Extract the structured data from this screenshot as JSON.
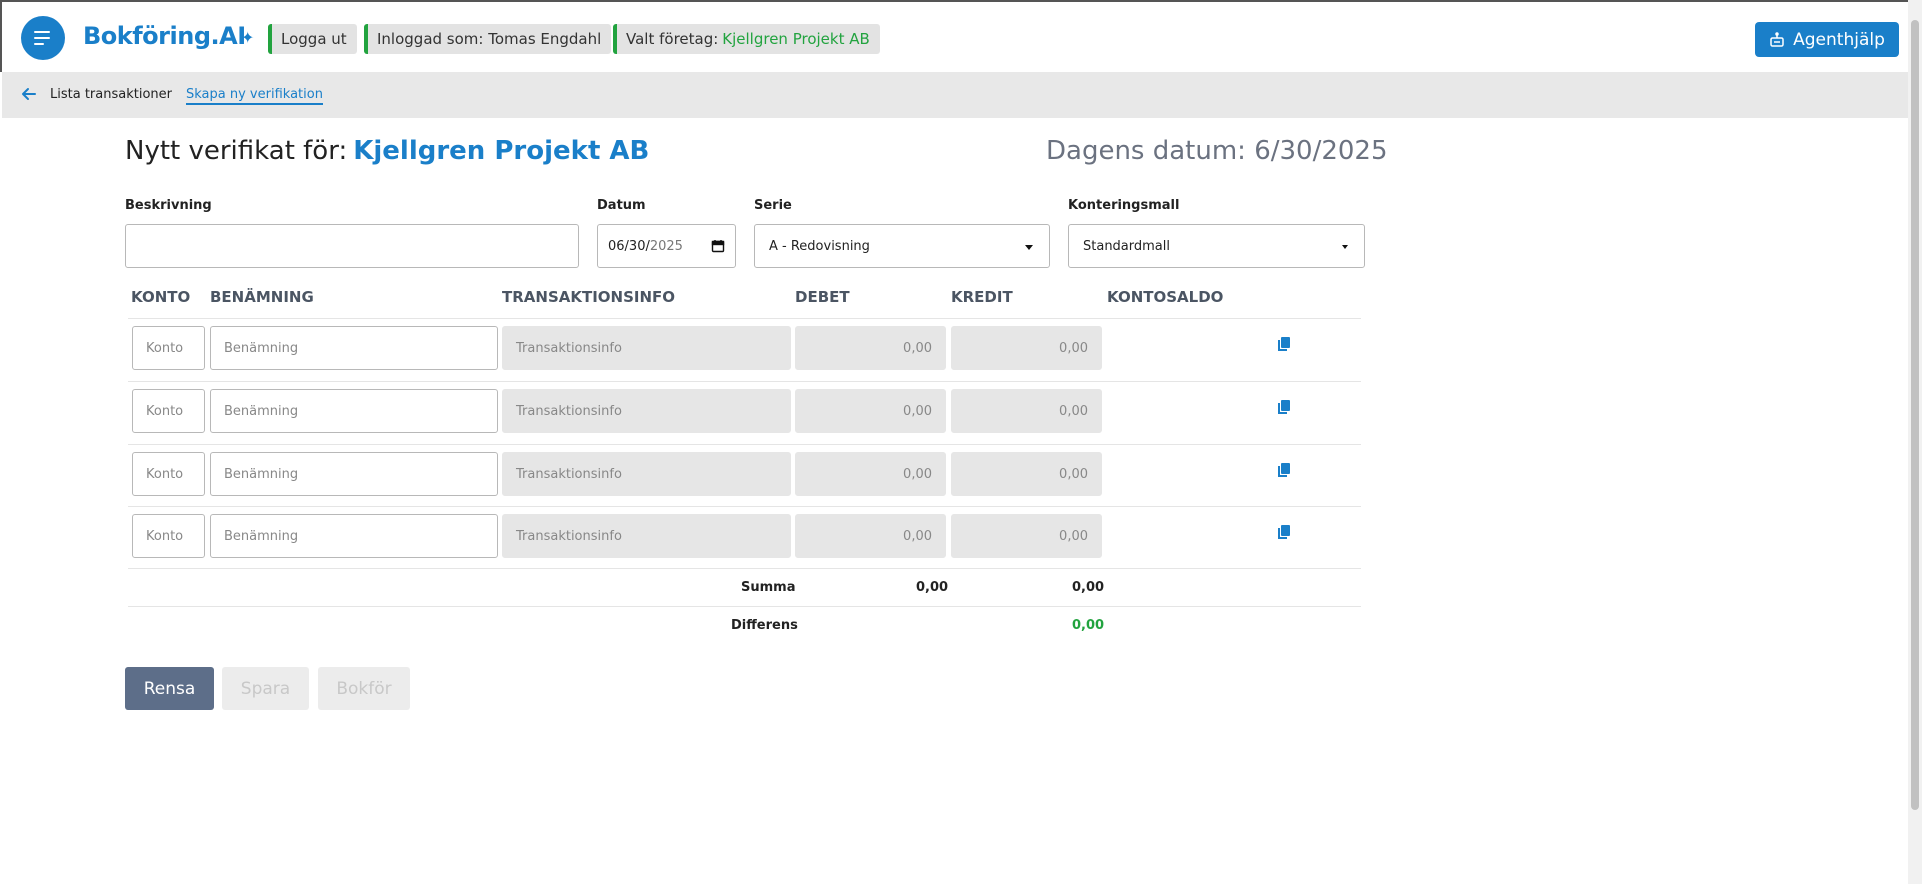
{
  "header": {
    "logo": "Bokföring.AI",
    "logo_star": "✦",
    "logout": "Logga ut",
    "logged_in": "Inloggad som: Tomas Engdahl",
    "company_label": "Valt företag:",
    "company_name": "Kjellgren Projekt AB",
    "agent_help": "Agenthjälp"
  },
  "breadcrumb": {
    "list": "Lista transaktioner",
    "active": "Skapa ny verifikation"
  },
  "page": {
    "title_prefix": "Nytt verifikat för:",
    "title_company": "Kjellgren Projekt AB",
    "today": "Dagens datum: 6/30/2025"
  },
  "form": {
    "description": {
      "label": "Beskrivning",
      "value": ""
    },
    "date": {
      "label": "Datum",
      "mmdd": "06/30/",
      "yyyy": "2025"
    },
    "series": {
      "label": "Serie",
      "value": "A - Redovisning"
    },
    "template": {
      "label": "Konteringsmall",
      "value": "Standardmall"
    }
  },
  "table": {
    "headers": [
      "KONTO",
      "BENÄMNING",
      "TRANSAKTIONSINFO",
      "DEBET",
      "KREDIT",
      "KONTOSALDO"
    ],
    "rows": [
      {
        "konto": "Konto",
        "benamning": "Benämning",
        "info": "Transaktionsinfo",
        "debet": "0,00",
        "kredit": "0,00"
      },
      {
        "konto": "Konto",
        "benamning": "Benämning",
        "info": "Transaktionsinfo",
        "debet": "0,00",
        "kredit": "0,00"
      },
      {
        "konto": "Konto",
        "benamning": "Benämning",
        "info": "Transaktionsinfo",
        "debet": "0,00",
        "kredit": "0,00"
      },
      {
        "konto": "Konto",
        "benamning": "Benämning",
        "info": "Transaktionsinfo",
        "debet": "0,00",
        "kredit": "0,00"
      }
    ],
    "summa": {
      "label": "Summa",
      "debet": "0,00",
      "kredit": "0,00"
    },
    "differens": {
      "label": "Differens",
      "value": "0,00"
    }
  },
  "buttons": {
    "clear": "Rensa",
    "save": "Spara",
    "post": "Bokför"
  },
  "colors": {
    "accent": "#1a7fc9",
    "success": "#22a33f",
    "primary_button": "#5d6e89"
  }
}
